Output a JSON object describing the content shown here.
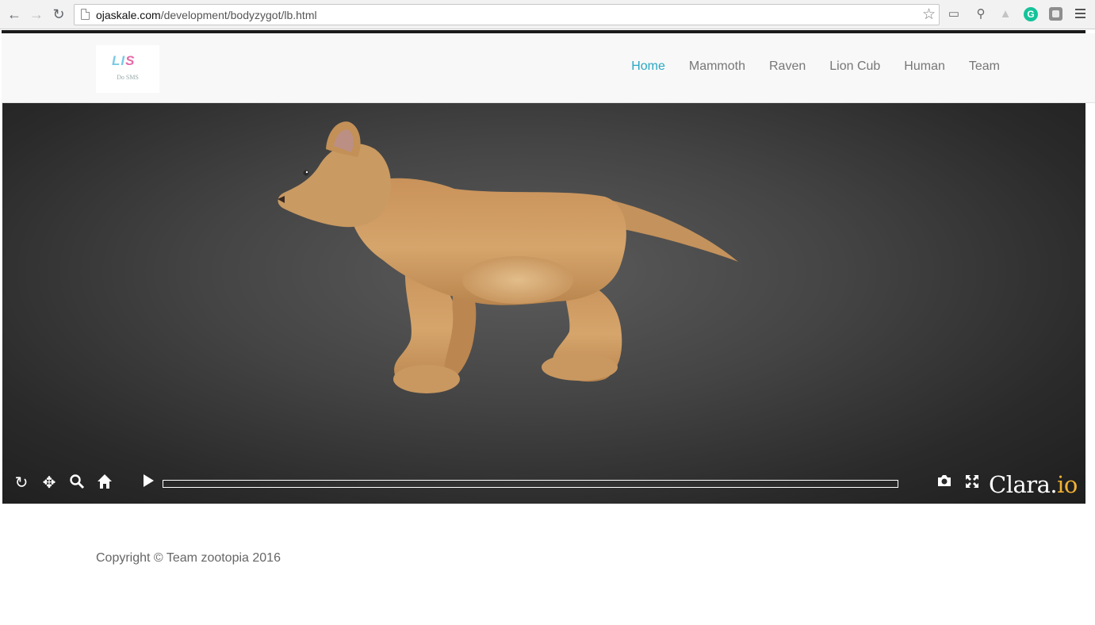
{
  "browser": {
    "url_host": "ojaskale.com",
    "url_path": "/development/bodyzygot/lb.html"
  },
  "header": {
    "logo_mark_a": "LI",
    "logo_mark_b": "S",
    "logo_sub": "Do SMS",
    "nav": [
      {
        "label": "Home",
        "active": true
      },
      {
        "label": "Mammoth"
      },
      {
        "label": "Raven"
      },
      {
        "label": "Lion Cub"
      },
      {
        "label": "Human"
      },
      {
        "label": "Team"
      }
    ]
  },
  "viewer": {
    "model": "lion-cub-3d-model",
    "progress": 0,
    "brand_main": "Clara.",
    "brand_accent": "io",
    "icons": [
      "rotate-icon",
      "pan-icon",
      "zoom-icon",
      "home-icon",
      "play-icon",
      "camera-icon",
      "fullscreen-icon"
    ]
  },
  "footer": {
    "copyright": "Copyright © Team zootopia 2016"
  },
  "colors": {
    "nav_active": "#2aa8c4",
    "brand_accent": "#f2b134"
  }
}
